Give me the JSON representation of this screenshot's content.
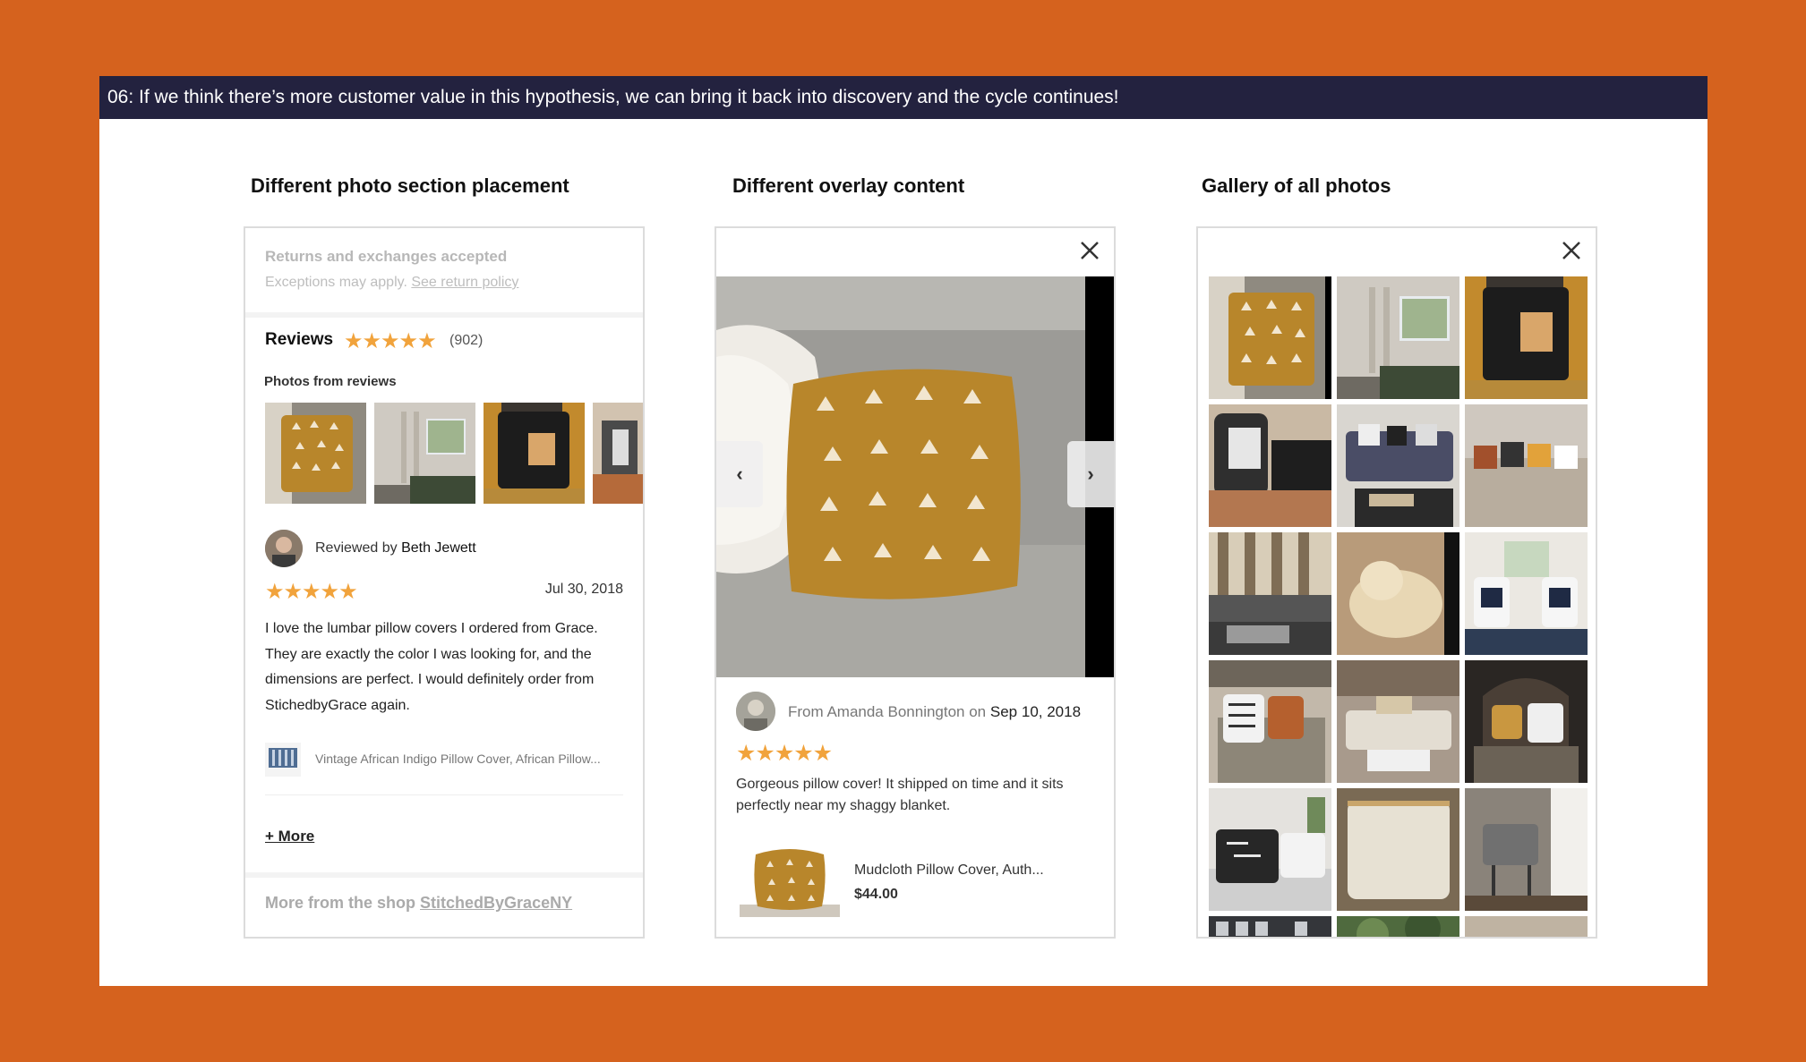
{
  "header": {
    "text": "06: If we think there’s more customer value in this hypothesis, we can bring it back into discovery and the cycle continues!"
  },
  "columns": [
    {
      "title": "Different photo section placement"
    },
    {
      "title": "Different overlay content"
    },
    {
      "title": "Gallery of all photos"
    }
  ],
  "panel1": {
    "returns_title": "Returns and exchanges accepted",
    "exceptions_text": "Exceptions may apply.",
    "return_policy_link": "See return policy",
    "reviews_title": "Reviews",
    "stars": "★★★★★",
    "review_count": "(902)",
    "photos_label": "Photos from reviews",
    "reviewed_by_prefix": "Reviewed by",
    "reviewer_name": "Beth Jewett",
    "review_stars": "★★★★★",
    "review_date": "Jul 30, 2018",
    "review_body": "I love the lumbar pillow covers I ordered from Grace. They are exactly the color I was looking for, and the dimensions are perfect. I would definitely order from StichedbyGrace again.",
    "item_title": "Vintage African Indigo Pillow Cover, African Pillow...",
    "more_label": "+ More",
    "shop_prefix": "More from the shop",
    "shop_name": "StitchedByGraceNY"
  },
  "panel2": {
    "close_icon": "close-icon",
    "prev_icon": "‹",
    "next_icon": "›",
    "from_prefix": "From Amanda Bonnington on",
    "review_date": "Sep 10, 2018",
    "stars": "★★★★★",
    "review_body": "Gorgeous pillow cover! It shipped on time and it sits perfectly near my shaggy blanket.",
    "product_name": "Mudcloth Pillow Cover, Auth...",
    "product_price": "$44.00"
  },
  "panel3": {
    "close_icon": "close-icon"
  },
  "colors": {
    "background": "#d5621e",
    "header_bar": "#23223f",
    "star": "#f1a33c",
    "mustard": "#b8862b"
  }
}
